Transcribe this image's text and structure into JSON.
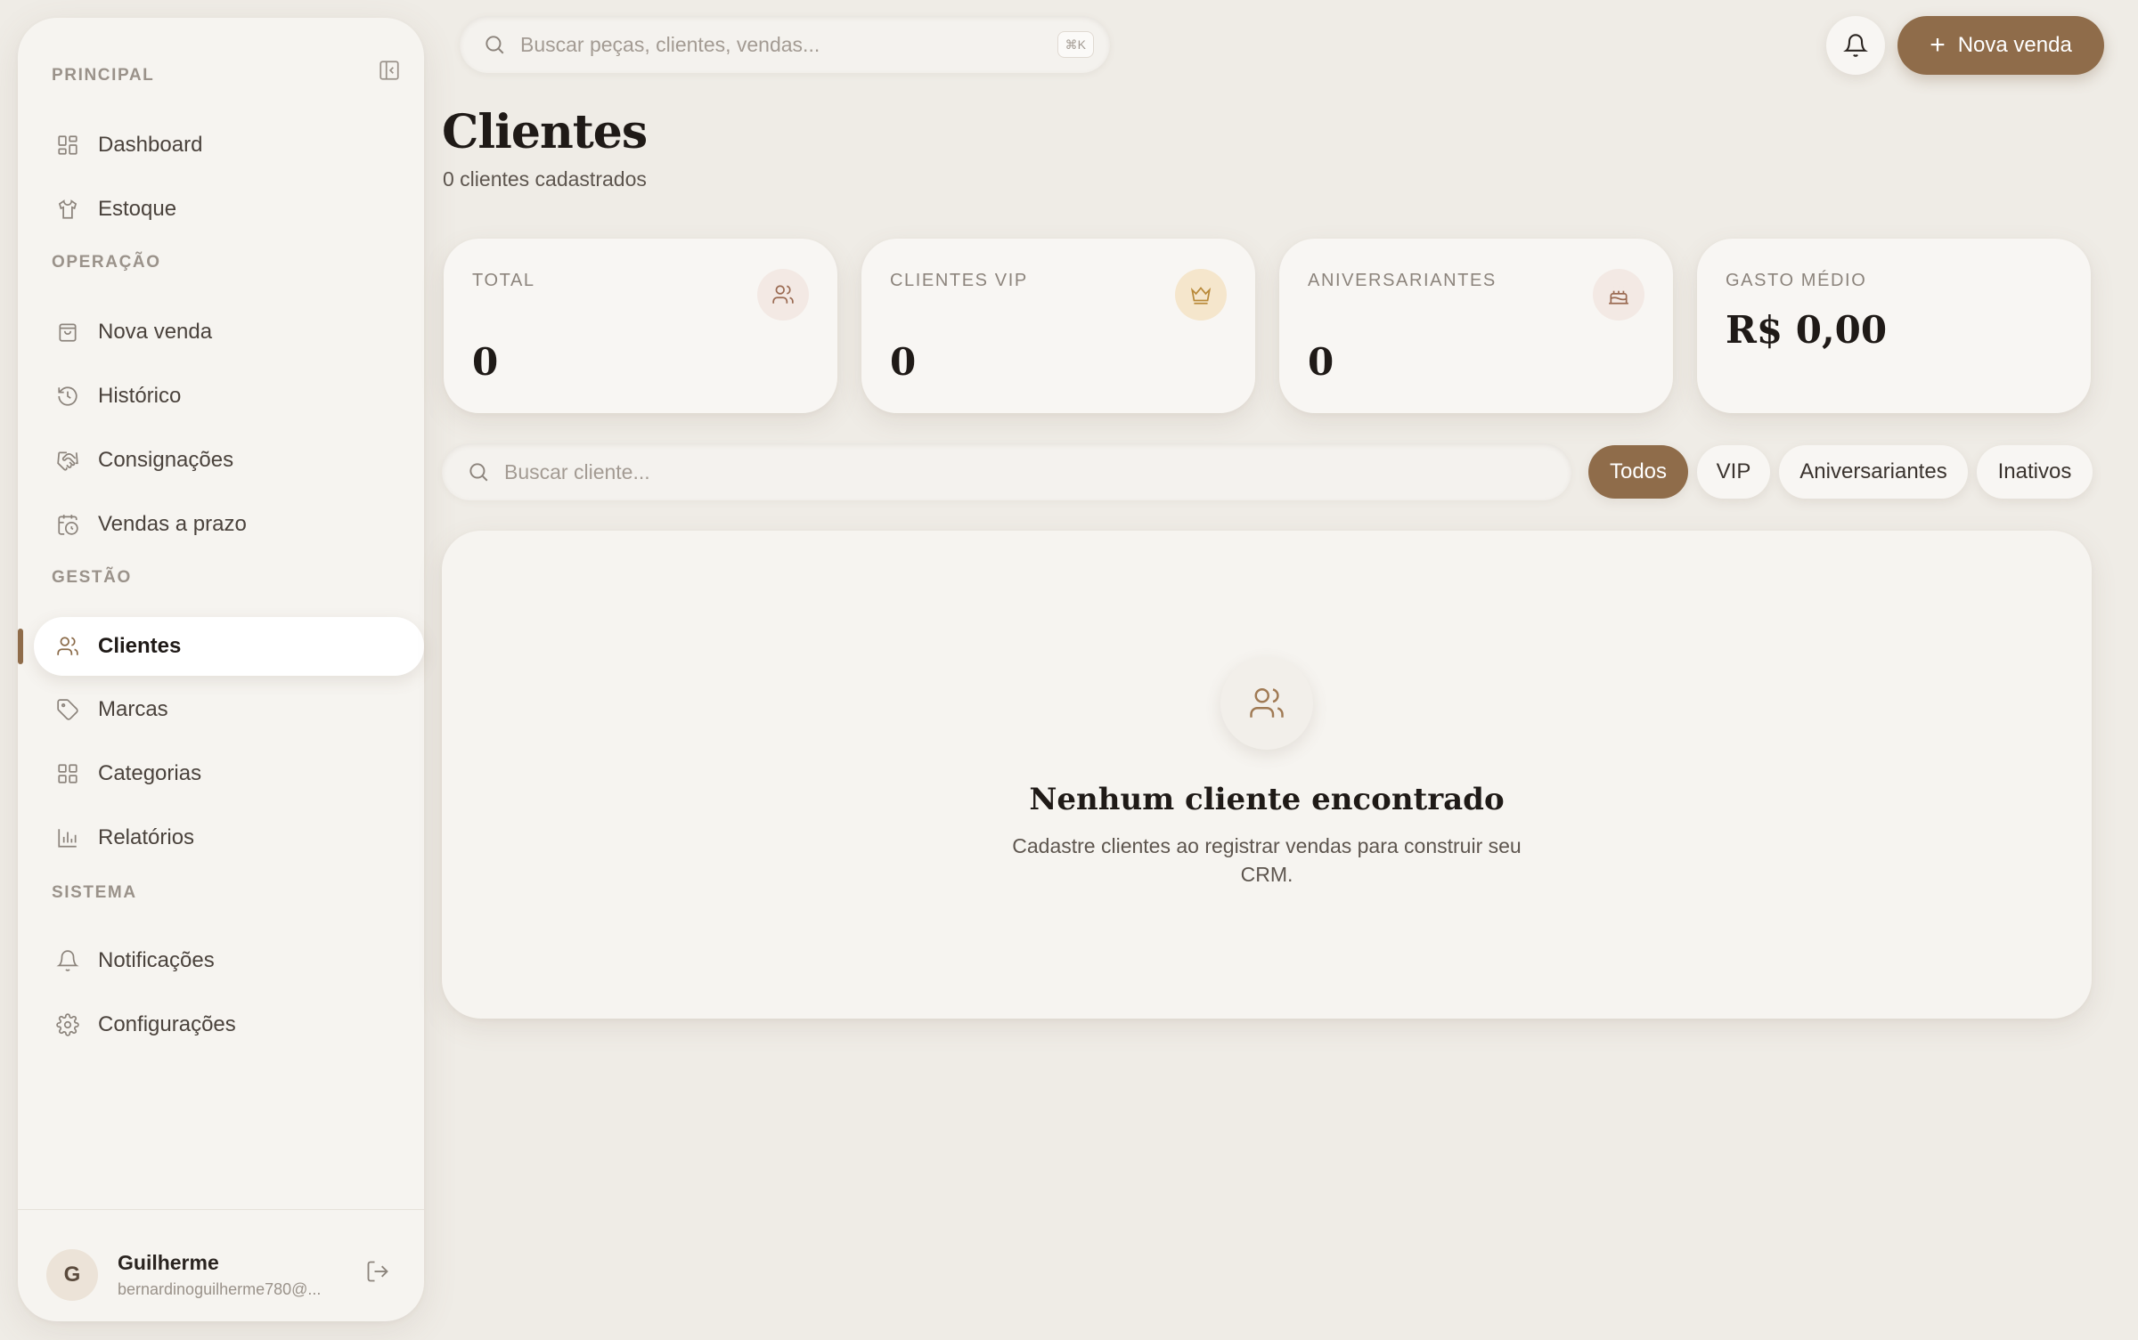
{
  "sidebar": {
    "sections": {
      "principal": "PRINCIPAL",
      "operacao": "OPERAÇÃO",
      "gestao": "GESTÃO",
      "sistema": "SISTEMA"
    },
    "items": {
      "dashboard": "Dashboard",
      "estoque": "Estoque",
      "nova_venda": "Nova venda",
      "historico": "Histórico",
      "consignacoes": "Consignações",
      "vendas_prazo": "Vendas a prazo",
      "clientes": "Clientes",
      "marcas": "Marcas",
      "categorias": "Categorias",
      "relatorios": "Relatórios",
      "notificacoes": "Notificações",
      "configuracoes": "Configurações"
    },
    "active_item": "clientes",
    "user": {
      "initial": "G",
      "name": "Guilherme",
      "email": "bernardinoguilherme780@..."
    }
  },
  "topbar": {
    "search_placeholder": "Buscar peças, clientes, vendas...",
    "shortcut": "⌘K",
    "new_sale_label": "Nova venda"
  },
  "page": {
    "title": "Clientes",
    "subtitle": "0 clientes cadastrados"
  },
  "stats": {
    "total": {
      "label": "TOTAL",
      "value": "0"
    },
    "vip": {
      "label": "CLIENTES VIP",
      "value": "0"
    },
    "aniversariantes": {
      "label": "ANIVERSARIANTES",
      "value": "0"
    },
    "gasto_medio": {
      "label": "GASTO MÉDIO",
      "value": "R$ 0,00"
    }
  },
  "filters": {
    "search_placeholder": "Buscar cliente...",
    "tabs": [
      "Todos",
      "VIP",
      "Aniversariantes",
      "Inativos"
    ],
    "active_tab": "Todos"
  },
  "empty_state": {
    "title": "Nenhum cliente encontrado",
    "description": "Cadastre clientes ao registrar vendas para construir seu CRM."
  },
  "colors": {
    "accent": "#8f6c4a",
    "background": "#efece6",
    "surface": "#f6f4f0"
  }
}
